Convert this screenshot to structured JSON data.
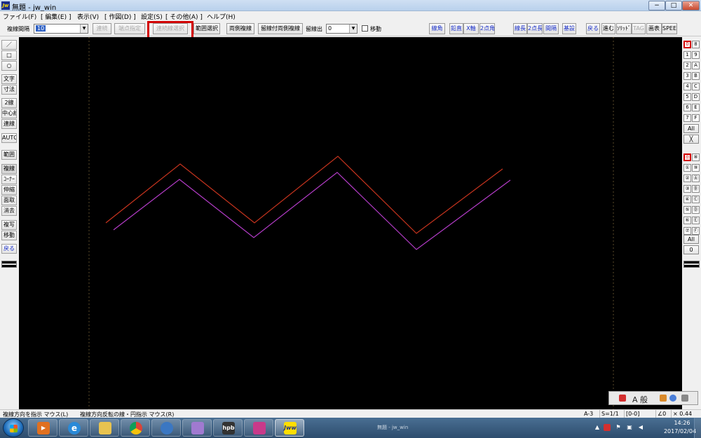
{
  "window": {
    "title": "無題 - jw_win",
    "icon_text": "Jw",
    "minimize": "−",
    "maximize": "□",
    "close": "✕"
  },
  "menu": {
    "items": [
      "ファイル(F)",
      "[ 編集(E) ]",
      "表示(V)",
      "[ 作図(D) ]",
      "設定(S)",
      "[ その他(A) ]",
      "ヘルプ(H)"
    ]
  },
  "toolbar": {
    "spacing_label": "複線間隔",
    "spacing_value": "10",
    "btn_continuous": "連続",
    "btn_endpoint": "端点指定",
    "btn_chain_select": "連続線選択",
    "btn_range_select": "範囲選択",
    "btn_both_sides": "両側複線",
    "btn_offset_both": "留線付両側複線",
    "offset_label": "留線出",
    "offset_value": "0",
    "move_label": "移動",
    "right_buttons": [
      "線角",
      "鉛直",
      "X軸",
      "2点角",
      "線長",
      "2点長",
      "間隔",
      "基設",
      "戻る",
      "進む",
      "ｿﾘｯﾄﾞ",
      "TAG",
      "画表",
      "SPEED"
    ]
  },
  "left_toolbar": {
    "buttons": [
      "／",
      "□",
      "○",
      "文字",
      "寸法",
      "2線",
      "中心線",
      "連線",
      "AUTO",
      "範囲",
      "複線",
      "ｺｰﾅｰ",
      "伸縮",
      "面取",
      "消去",
      "複写",
      "移動",
      "戻る"
    ]
  },
  "right_toolbar": {
    "layer_groups": [
      "0",
      "8",
      "1",
      "9",
      "2",
      "A",
      "3",
      "B",
      "4",
      "C",
      "5",
      "D",
      "6",
      "E",
      "7",
      "F"
    ],
    "layers": [
      "⓪",
      "⑧",
      "①",
      "⑨",
      "②",
      "Ⓐ",
      "③",
      "Ⓑ",
      "④",
      "Ⓒ",
      "⑤",
      "Ⓓ",
      "⑥",
      "Ⓔ",
      "⑦",
      "Ⓕ"
    ],
    "all_label_top": "All",
    "cross_label": "╳",
    "all_label_bottom": "All",
    "zero_label": "0"
  },
  "ime": {
    "mode": "A 般"
  },
  "status": {
    "message_left": "複線方向を指示 マウス(L)",
    "message_right": "複線方向反転の線・円指示 マウス(R)",
    "paper": "A-3",
    "scale": "S=1/1",
    "layer": "[0-0]",
    "angle": "∠0",
    "zoom": "× 0.44"
  },
  "taskbar": {
    "running_window": "無題 - jw_win",
    "apps": [
      "media-player-icon",
      "ie-icon",
      "explorer-icon",
      "chrome-icon",
      "thunderbird-icon",
      "paint-icon",
      "hpb-icon",
      "game-icon",
      "jww-icon"
    ],
    "hpb_label": "hpb",
    "jww_label": "Jww",
    "clock_time": "14:26",
    "clock_date": "2017/02/04"
  },
  "colors": {
    "canvas_bg": "#000000",
    "original_line": "#c8341e",
    "offset_line": "#b43cc8",
    "highlight_box": "#d30000",
    "guide_line": "#5a4a2a"
  }
}
